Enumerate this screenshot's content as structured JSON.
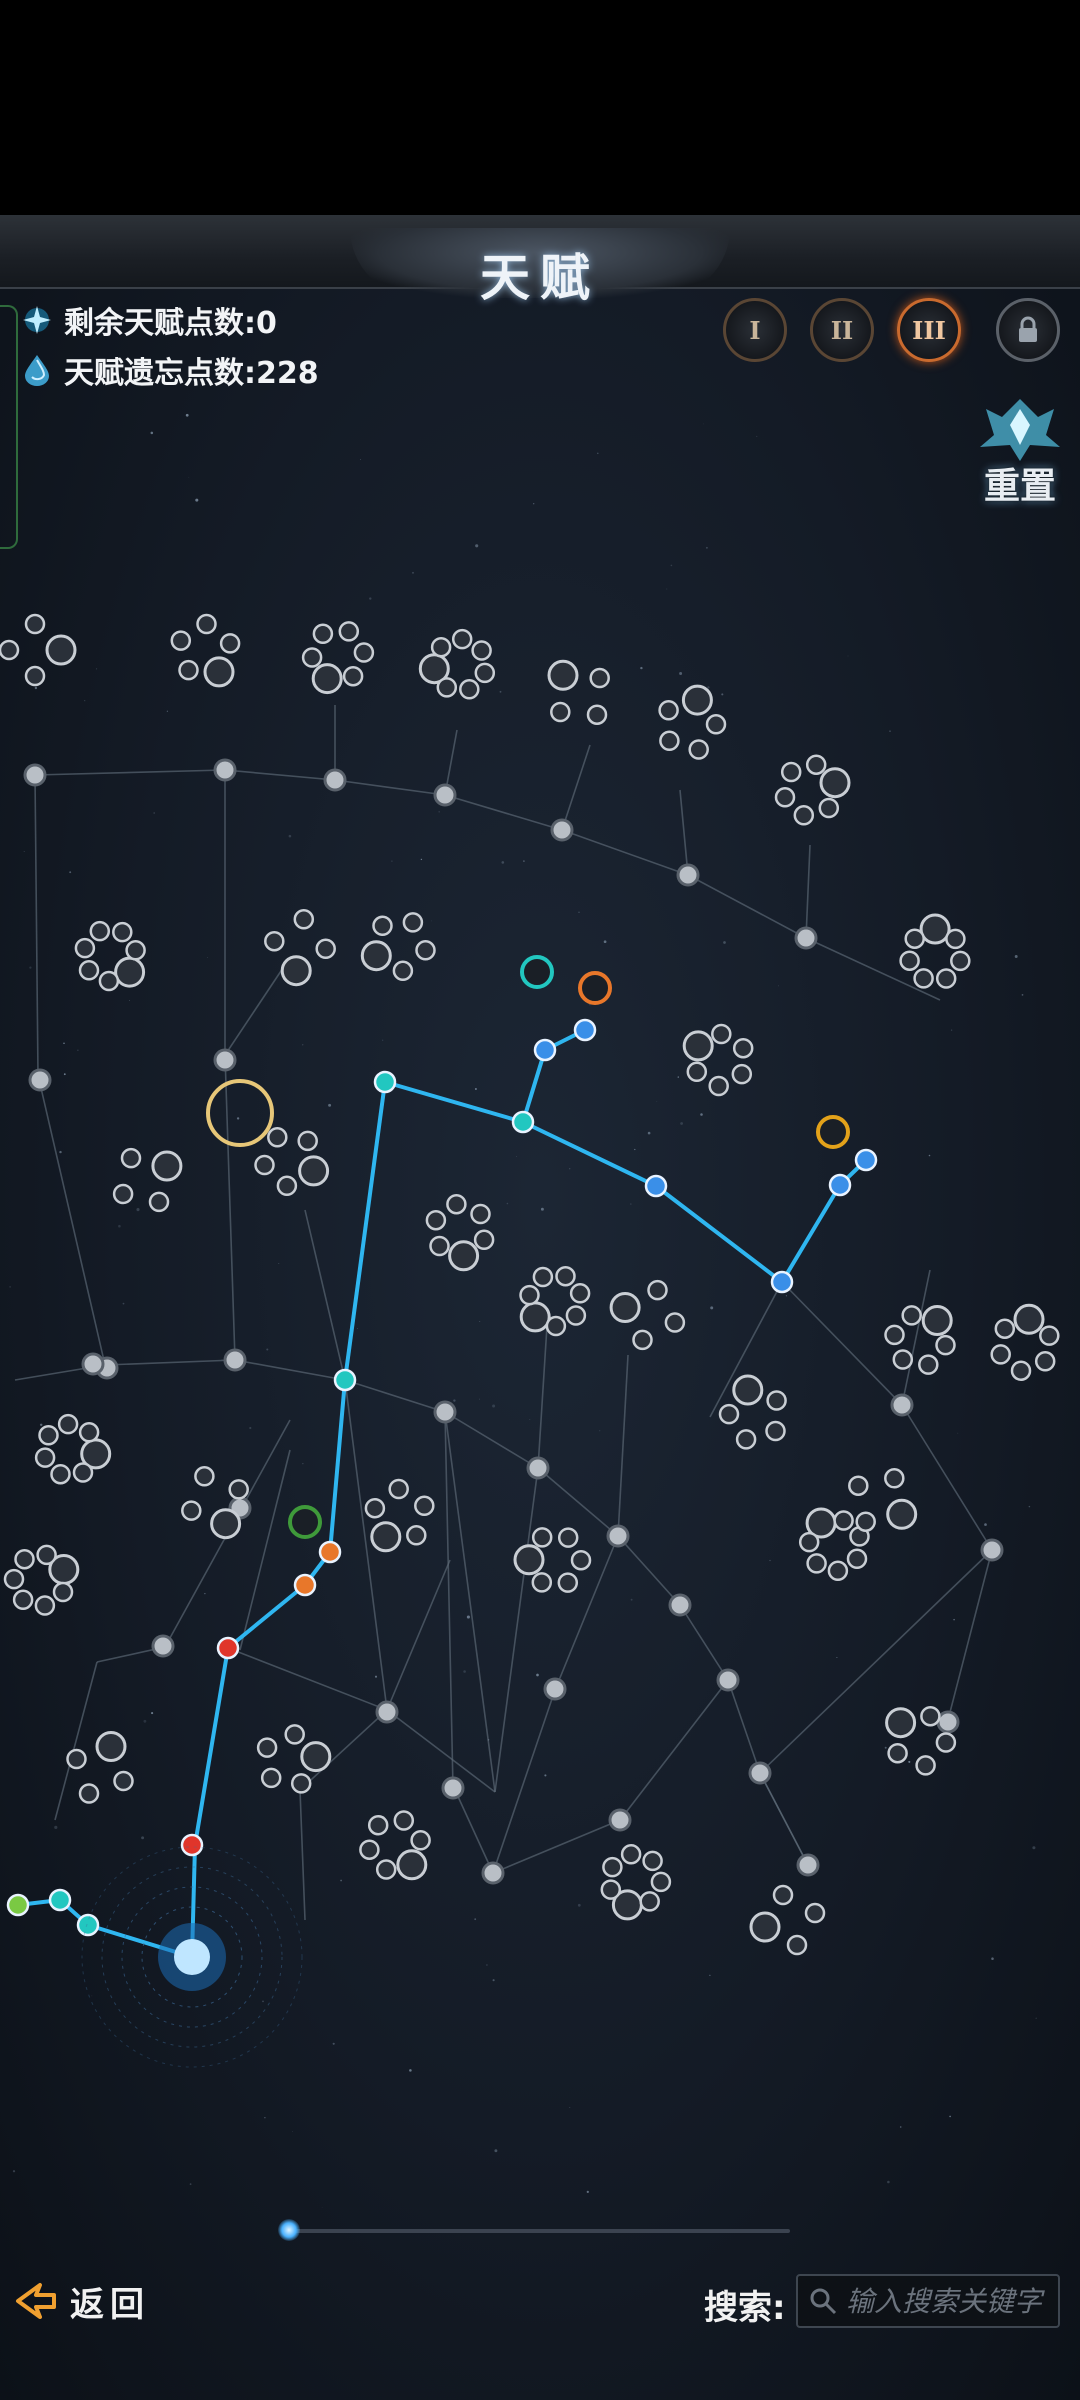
{
  "header": {
    "title": "天赋"
  },
  "stats": {
    "remaining_points": "剩余天赋点数:0",
    "forget_points": "天赋遗忘点数:228"
  },
  "tiers": [
    {
      "label": "I",
      "state": "available"
    },
    {
      "label": "II",
      "state": "available"
    },
    {
      "label": "III",
      "state": "selected"
    },
    {
      "label": "",
      "icon": "lock-icon",
      "state": "locked"
    }
  ],
  "reset": {
    "label": "重置"
  },
  "footer": {
    "back_label": "返回",
    "search_label": "搜索:",
    "search_placeholder": "输入搜索关键字"
  },
  "colors": {
    "active_path": "#2fb6f0",
    "inactive_path": "#5e6b78",
    "node_inactive": "#b9bfc6",
    "node_teal": "#22c7c0",
    "node_blue": "#3a8fe8",
    "node_red": "#e0352b",
    "node_orange": "#e8772a",
    "node_gold": "#e3a21a"
  }
}
